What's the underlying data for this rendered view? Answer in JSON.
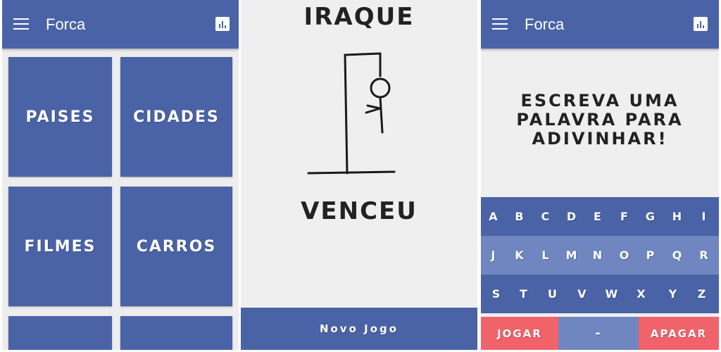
{
  "screen1": {
    "appbar_title": "Forca",
    "categories": [
      "PAISES",
      "CIDADES",
      "FILMES",
      "CARROS"
    ]
  },
  "screen2": {
    "word": "IRAQUE",
    "result": "VENCEU",
    "new_game": "Novo Jogo"
  },
  "screen3": {
    "appbar_title": "Forca",
    "prompt": [
      "ESCREVA UMA",
      "PALAVRA PARA",
      "ADIVINHAR!"
    ],
    "keyboard_rows": [
      [
        "A",
        "B",
        "C",
        "D",
        "E",
        "F",
        "G",
        "H",
        "I"
      ],
      [
        "J",
        "K",
        "L",
        "M",
        "N",
        "O",
        "P",
        "Q",
        "R"
      ],
      [
        "S",
        "T",
        "U",
        "V",
        "W",
        "X",
        "Y",
        "Z"
      ]
    ],
    "play_button": "JOGAR",
    "space_key": "-",
    "delete_button": "APAGAR"
  },
  "colors": {
    "primary": "#4a63a6",
    "keyboard_alt": "#6f86c0",
    "action": "#f0636b",
    "background": "#efefef"
  },
  "icons": [
    "menu-icon",
    "stats-icon"
  ]
}
